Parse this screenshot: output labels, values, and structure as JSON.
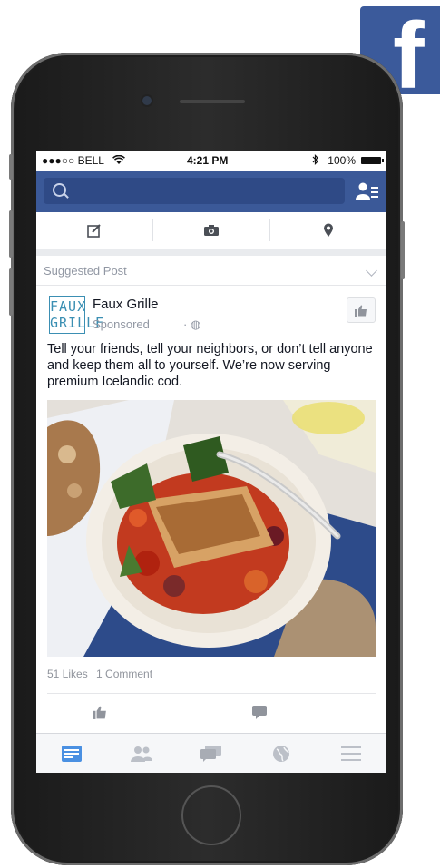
{
  "status_bar": {
    "carrier": "●●●○○ BELL",
    "time": "4:21 PM",
    "battery": "100%"
  },
  "nav": {
    "search_placeholder": ""
  },
  "compose": {
    "icons": [
      "edit-icon",
      "camera-icon",
      "location-pin-icon"
    ]
  },
  "post": {
    "section_label": "Suggested Post",
    "page_logo_text": "FAUX GRILLE",
    "page_name": "Faux Grille",
    "sponsored_label": "Sponsored",
    "text": "Tell your friends, tell your neighbors, or don’t tell anyone and keep them all to yourself. We’re now serving premium Icelandic cod.",
    "likes": "51 Likes",
    "comments": "1 Comment"
  },
  "tab_bar": {
    "icons": [
      "news-feed-icon",
      "friends-icon",
      "messages-icon",
      "globe-icon",
      "menu-icon"
    ]
  },
  "colors": {
    "brand": "#3b5998",
    "active_tab": "#4a90e2",
    "inactive_icon": "#bcc0c8"
  }
}
